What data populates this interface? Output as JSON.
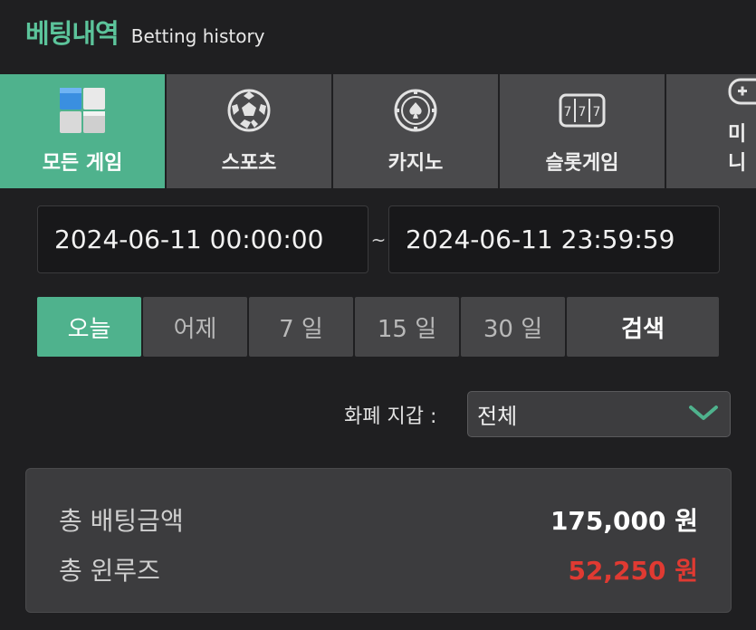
{
  "header": {
    "title": "베팅내역",
    "subtitle": "Betting history"
  },
  "tabs": [
    {
      "label": "모든 게임",
      "icon": "cubes-icon",
      "active": true
    },
    {
      "label": "스포츠",
      "icon": "soccer-ball-icon",
      "active": false
    },
    {
      "label": "카지노",
      "icon": "casino-chip-icon",
      "active": false
    },
    {
      "label": "슬롯게임",
      "icon": "slot-machine-icon",
      "active": false
    },
    {
      "label": "미니",
      "icon": "gamepad-icon",
      "active": false
    }
  ],
  "date_range": {
    "start": "2024-06-11 00:00:00",
    "separator": "~",
    "end": "2024-06-11 23:59:59"
  },
  "periods": [
    {
      "label": "오늘",
      "active": true
    },
    {
      "label": "어제",
      "active": false
    },
    {
      "label": "7 일",
      "active": false
    },
    {
      "label": "15 일",
      "active": false
    },
    {
      "label": "30 일",
      "active": false
    }
  ],
  "search_label": "검색",
  "currency": {
    "label": "화폐 지갑 :",
    "selected": "전체"
  },
  "summary": {
    "total_bet_label": "총 배팅금액",
    "total_bet_value": "175,000 원",
    "total_win_label": "총 윈루즈",
    "total_win_value": "52,250 원"
  },
  "colors": {
    "accent": "#4fb28d",
    "loss": "#e03a32"
  }
}
